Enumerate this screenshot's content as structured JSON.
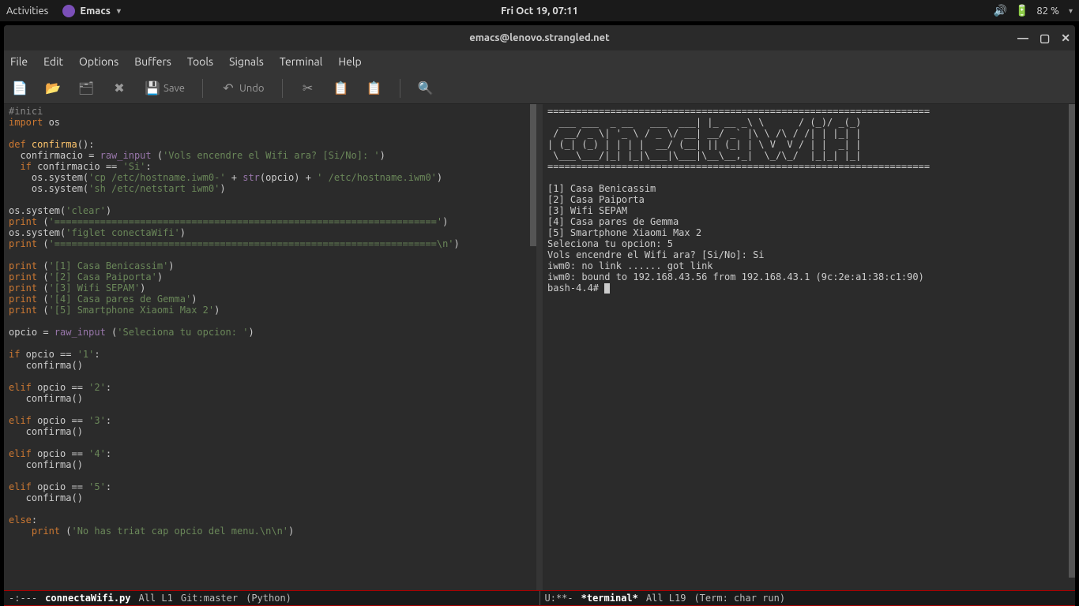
{
  "topbar": {
    "activities": "Activities",
    "appname": "Emacs",
    "clock": "Fri Oct 19, 07:11",
    "battery": "82 %"
  },
  "window": {
    "title": "emacs@lenovo.strangled.net"
  },
  "menubar": [
    "File",
    "Edit",
    "Options",
    "Buffers",
    "Tools",
    "Signals",
    "Terminal",
    "Help"
  ],
  "toolbar": {
    "save": "Save",
    "undo": "Undo"
  },
  "terminal": {
    "divider": "===================================================================",
    "ascii1": "  ___ ___  _ __   ___  ___| |_ __ _\\ \\      / (_)/ _(_)",
    "ascii2": " / __/ _ \\| '_ \\ / _ \\/ __| __/ _` |\\ \\ /\\ / /| | |_| |",
    "ascii3": "| (_| (_) | | | |  __/ (__| || (_| | \\ V  V / | |  _| |",
    "ascii4": " \\___\\___/|_| |_|\\___|\\___|\\__\\__,_|  \\_/\\_/  |_|_| |_|",
    "opt1": "[1] Casa Benicassim",
    "opt2": "[2] Casa Paiporta",
    "opt3": "[3] Wifi SEPAM",
    "opt4": "[4] Casa pares de Gemma",
    "opt5": "[5] Smartphone Xiaomi Max 2",
    "sel": "Seleciona tu opcion: 5",
    "q": "Vols encendre el Wifi ara? [Si/No]: Si",
    "l1": "iwm0: no link ...... got link",
    "l2": "iwm0: bound to 192.168.43.56 from 192.168.43.1 (9c:2e:a1:38:c1:90)",
    "prompt": "bash-4.4# "
  },
  "modeline_left": {
    "state": "-:---",
    "file": "connectaWifi.py",
    "pos": "All L1",
    "vcs": "Git:master",
    "mode": "(Python)"
  },
  "modeline_right": {
    "state": "U:**-",
    "file": "*terminal*",
    "pos": "All L19",
    "mode": "(Term: char run)"
  }
}
